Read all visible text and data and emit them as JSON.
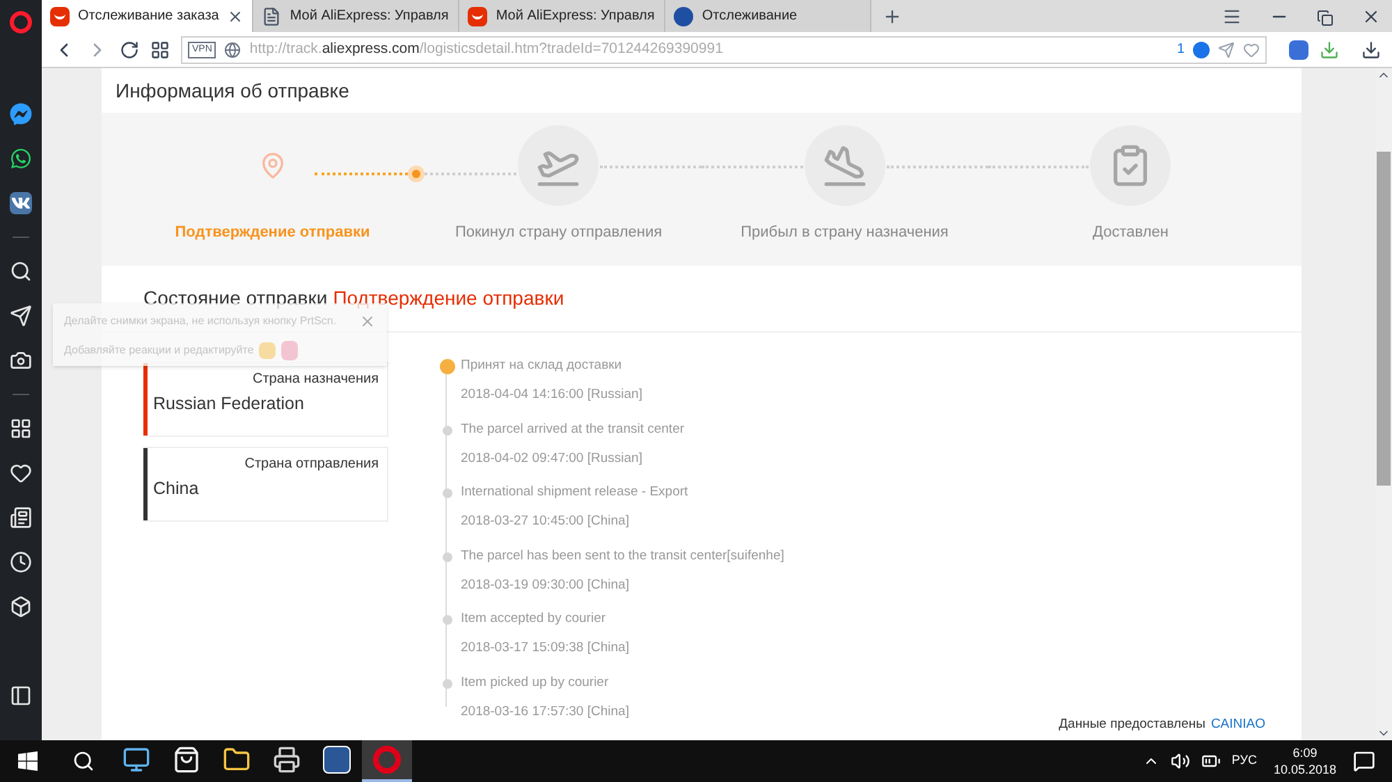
{
  "browser": {
    "tabs": [
      {
        "title": "Отслеживание заказа",
        "kind": "aliexpress",
        "selected": true
      },
      {
        "title": "Мой AliExpress: Управля",
        "kind": "page",
        "selected": false
      },
      {
        "title": "Мой AliExpress: Управля",
        "kind": "aliexpress",
        "selected": false
      },
      {
        "title": "Отслеживание",
        "kind": "emblem",
        "selected": false
      }
    ],
    "vpn_badge": "VPN",
    "url": {
      "prefix": "http://track.",
      "host": "aliexpress.com",
      "path": "/logisticsdetail.htm?tradeId=701244269390991"
    },
    "address_badge": "1"
  },
  "page": {
    "title": "Информация об отправке",
    "steps": [
      {
        "label": "Подтверждение отправки",
        "kind": "start",
        "selected": true
      },
      {
        "label": "Покинул страну отправления",
        "kind": "takeoff",
        "selected": false
      },
      {
        "label": "Прибыл в страну назначения",
        "kind": "landing",
        "selected": false
      },
      {
        "label": "Доставлен",
        "kind": "delivered",
        "selected": false
      }
    ],
    "status": {
      "label": "Состояние отправки",
      "value": "Подтверждение отправки"
    },
    "countries": [
      {
        "label": "Страна назначения",
        "value": "Russian Federation",
        "color": "#e62e04"
      },
      {
        "label": "Страна отправления",
        "value": "China",
        "color": "#333333"
      }
    ],
    "events": [
      {
        "text": "Принят на склад доставки",
        "time": "2018-04-04 14:16:00 [Russian]",
        "selected": true
      },
      {
        "text": "The parcel arrived at the transit center",
        "time": "2018-04-02 09:47:00 [Russian]",
        "selected": false
      },
      {
        "text": "International shipment release - Export",
        "time": "2018-03-27 10:45:00 [China]",
        "selected": false
      },
      {
        "text": "The parcel has been sent to the transit center[suifenhe]",
        "time": "2018-03-19 09:30:00 [China]",
        "selected": false
      },
      {
        "text": "Item accepted by courier",
        "time": "2018-03-17 15:09:38 [China]",
        "selected": false
      },
      {
        "text": "Item picked up by courier",
        "time": "2018-03-16 17:57:30 [China]",
        "selected": false
      }
    ],
    "source_label": "Данные предоставлены",
    "source_link": "CAINIAO"
  },
  "snapshot_hint": {
    "line_1": "Делайте снимки экрана, не используя кнопку PrtScn.",
    "line_2": "Добавляйте реакции и редактируйте"
  },
  "taskbar": {
    "apps": [
      {
        "kind": "monitor",
        "selected": false
      },
      {
        "kind": "store",
        "selected": false
      },
      {
        "kind": "folder",
        "selected": false
      },
      {
        "kind": "printer",
        "selected": false
      },
      {
        "kind": "word",
        "selected": false
      },
      {
        "kind": "opera",
        "selected": true
      }
    ],
    "language": "РУС",
    "time": "6:09",
    "date": "10.05.2018"
  }
}
